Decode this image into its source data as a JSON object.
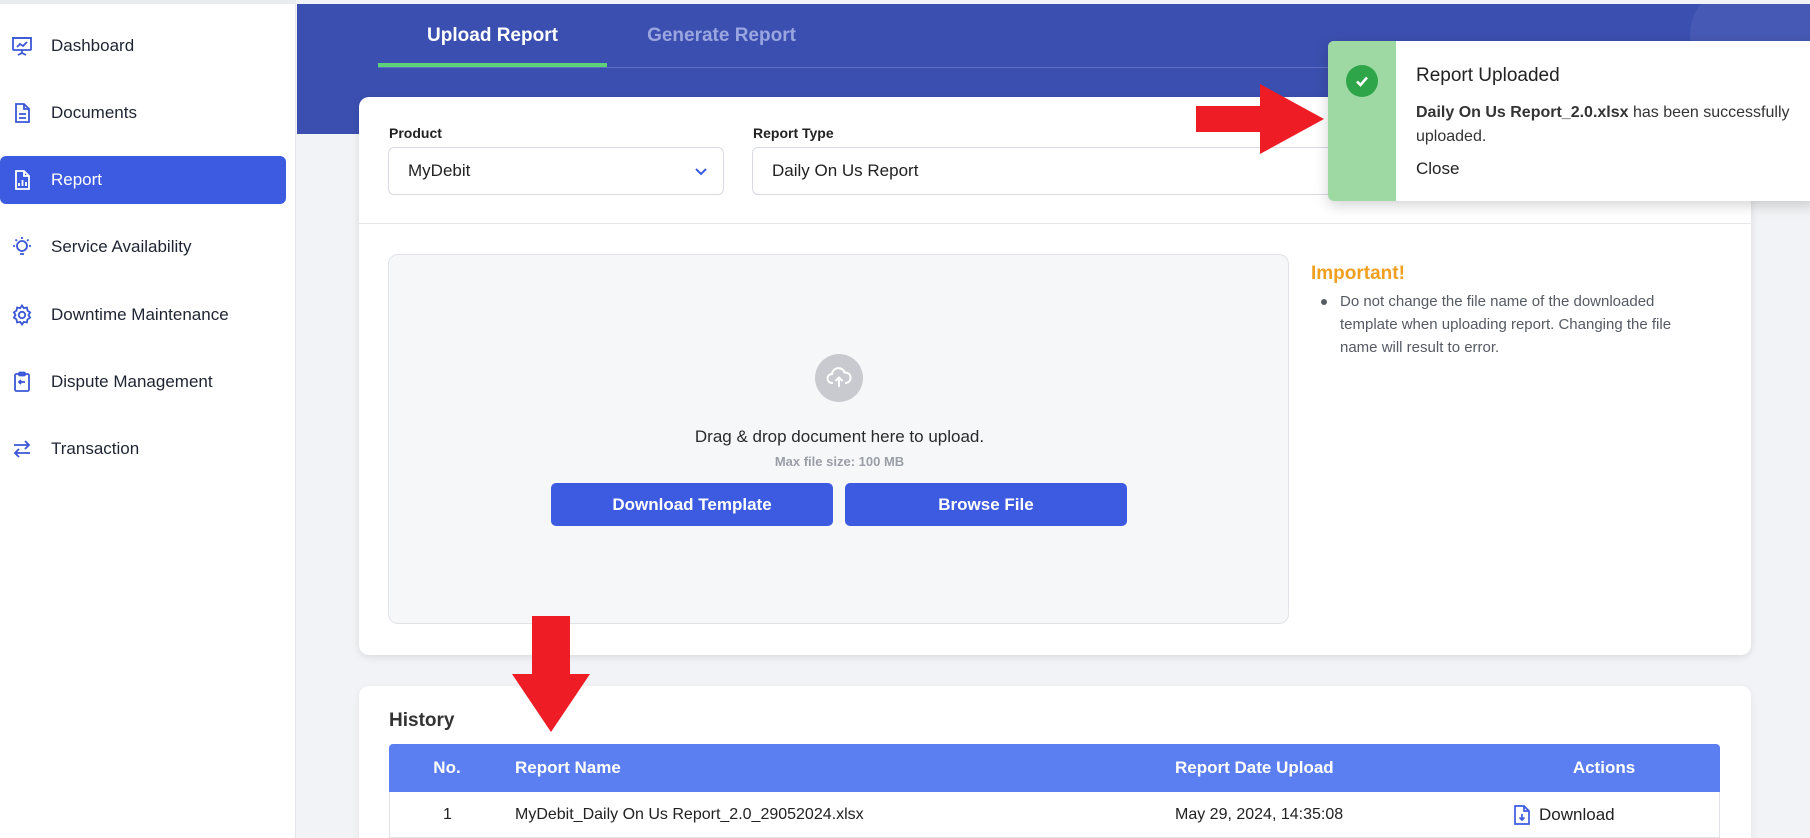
{
  "sidebar": {
    "items": [
      {
        "label": "Dashboard",
        "icon": "presentation-chart-icon"
      },
      {
        "label": "Documents",
        "icon": "document-icon"
      },
      {
        "label": "Report",
        "icon": "report-chart-icon",
        "active": true
      },
      {
        "label": "Service Availability",
        "icon": "lightbulb-icon"
      },
      {
        "label": "Downtime Maintenance",
        "icon": "gear-icon"
      },
      {
        "label": "Dispute Management",
        "icon": "clipboard-icon"
      },
      {
        "label": "Transaction",
        "icon": "arrows-exchange-icon"
      }
    ]
  },
  "tabs": {
    "upload": "Upload Report",
    "generate": "Generate Report"
  },
  "form": {
    "product_label": "Product",
    "product_value": "MyDebit",
    "report_type_label": "Report Type",
    "report_type_value": "Daily On Us Report"
  },
  "dropzone": {
    "text": "Drag & drop document here to upload.",
    "max_size": "Max file size: 100 MB",
    "download_template": "Download Template",
    "browse_file": "Browse File"
  },
  "important": {
    "title": "Important!",
    "note": "Do not change the file name of the downloaded template when uploading report. Changing the file name will result to error."
  },
  "history": {
    "title": "History",
    "columns": {
      "no": "No.",
      "name": "Report Name",
      "date": "Report Date Upload",
      "actions": "Actions"
    },
    "rows": [
      {
        "no": "1",
        "name": "MyDebit_Daily On Us Report_2.0_29052024.xlsx",
        "date": "May 29, 2024, 14:35:08",
        "action": "Download"
      }
    ]
  },
  "toast": {
    "title": "Report Uploaded",
    "filename": "Daily On Us Report_2.0.xlsx",
    "message": " has been successfully uploaded.",
    "close": "Close"
  },
  "colors": {
    "primary": "#3d5be0",
    "header": "#3b4fb0",
    "table_header": "#5b7ff0",
    "success": "#2fa54a",
    "warning": "#f0a020",
    "annotation": "#ee1c24"
  }
}
